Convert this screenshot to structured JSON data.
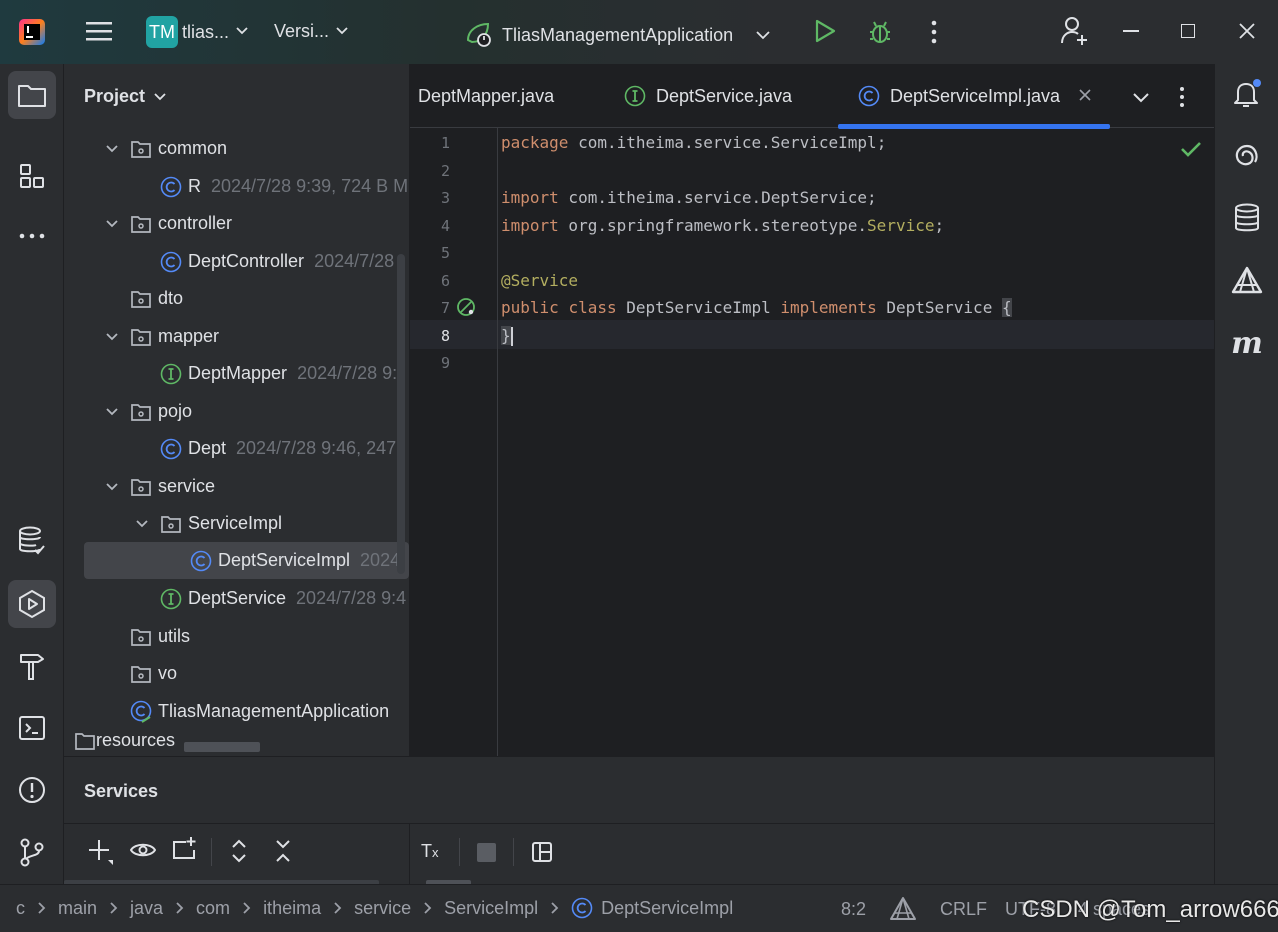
{
  "titlebar": {
    "project_badge": "TM",
    "project_name": "tlias...",
    "vcs_label": "Versi...",
    "run_config": "TliasManagementApplication"
  },
  "project_panel": {
    "title": "Project",
    "rows": [
      {
        "name": "common",
        "meta": ""
      },
      {
        "name": "R",
        "meta": "2024/7/28 9:39, 724 B M"
      },
      {
        "name": "controller",
        "meta": ""
      },
      {
        "name": "DeptController",
        "meta": "2024/7/28"
      },
      {
        "name": "dto",
        "meta": ""
      },
      {
        "name": "mapper",
        "meta": ""
      },
      {
        "name": "DeptMapper",
        "meta": "2024/7/28 9:"
      },
      {
        "name": "pojo",
        "meta": ""
      },
      {
        "name": "Dept",
        "meta": "2024/7/28 9:46, 247"
      },
      {
        "name": "service",
        "meta": ""
      },
      {
        "name": "ServiceImpl",
        "meta": ""
      },
      {
        "name": "DeptServiceImpl",
        "meta": "2024"
      },
      {
        "name": "DeptService",
        "meta": "2024/7/28 9:4"
      },
      {
        "name": "utils",
        "meta": ""
      },
      {
        "name": "vo",
        "meta": ""
      },
      {
        "name": "TliasManagementApplication",
        "meta": ""
      },
      {
        "name": "resources",
        "meta": ""
      }
    ]
  },
  "editor": {
    "tabs": [
      {
        "label": "DeptMapper.java"
      },
      {
        "label": "DeptService.java"
      },
      {
        "label": "DeptServiceImpl.java"
      }
    ],
    "line_numbers": [
      "1",
      "2",
      "3",
      "4",
      "5",
      "6",
      "7",
      "8",
      "9"
    ],
    "code": {
      "l1_kw": "package",
      "l1_rest": " com.itheima.service.ServiceImpl;",
      "l3_kw": "import",
      "l3_rest": " com.itheima.service.DeptService;",
      "l4_kw": "import",
      "l4_rest": " org.springframework.stereotype.",
      "l4_ann": "Service",
      "l4_end": ";",
      "l6_ann": "@Service",
      "l7_kw1": "public",
      "l7_kw2": "class",
      "l7_name": "DeptServiceImpl",
      "l7_kw3": "implements",
      "l7_iface": "DeptService",
      "l7_brace": "{",
      "l8_brace": "}"
    }
  },
  "services": {
    "title": "Services"
  },
  "statusbar": {
    "breadcrumbs": [
      "c",
      "main",
      "java",
      "com",
      "itheima",
      "service",
      "ServiceImpl",
      "DeptServiceImpl"
    ],
    "position": "8:2",
    "line_sep": "CRLF",
    "encoding": "UTF-8",
    "indent": "4 spaces"
  },
  "watermark": "CSDN @Tom_arrow666",
  "colors": {
    "accent": "#3574f0",
    "class_icon": "#548af7",
    "interface_icon": "#5fb865",
    "keyword": "#cf8e6d",
    "annotation": "#b3ae60"
  }
}
